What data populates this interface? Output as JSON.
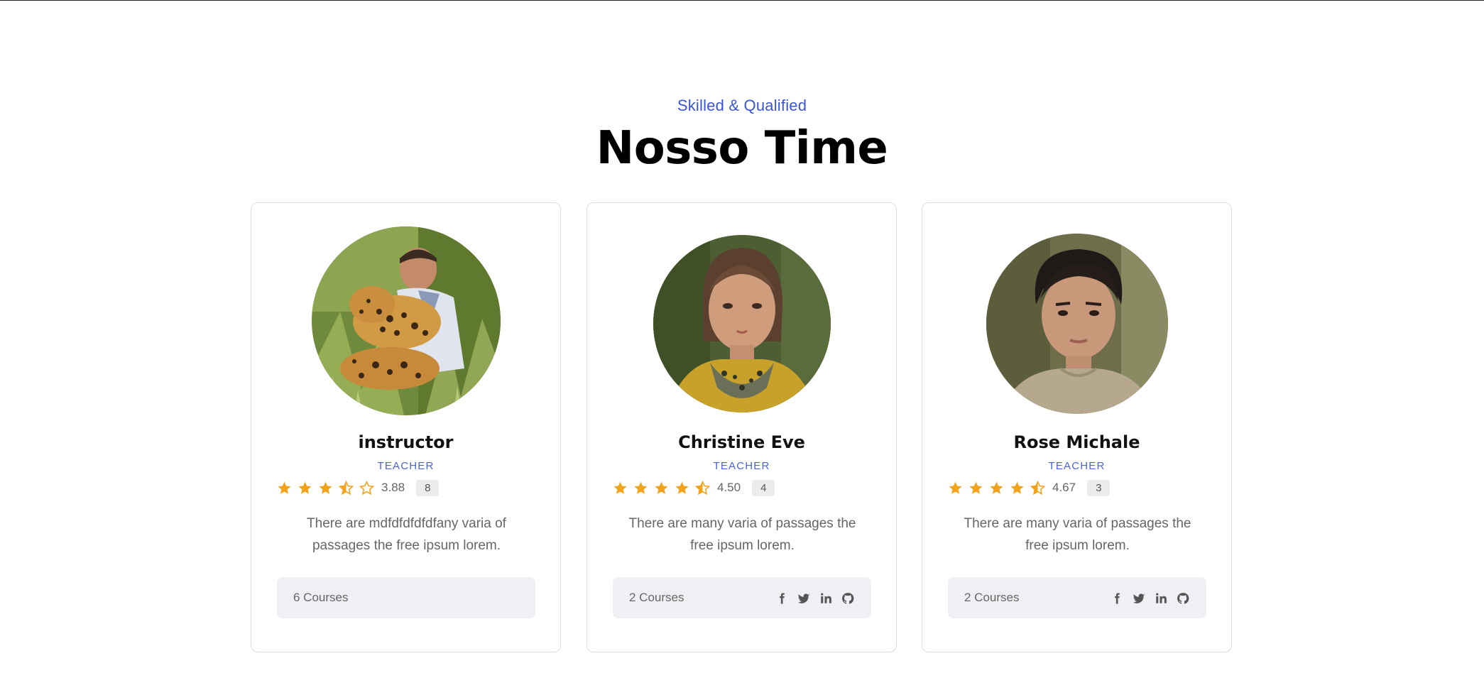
{
  "header": {
    "eyebrow": "Skilled & Qualified",
    "title": "Nosso Time"
  },
  "colors": {
    "accent": "#3a55d6",
    "star": "#f2a31b",
    "card_border": "#dcdce3",
    "footer_bg": "#eff0f4"
  },
  "instructors": [
    {
      "name": "instructor",
      "role": "TEACHER",
      "stars": [
        "star-full-icon",
        "star-full-icon",
        "star-full-icon",
        "star-half-icon",
        "star-empty-icon"
      ],
      "rating": "3.88",
      "review_count": "8",
      "description": "There are mdfdfdfdfdfany varia of passages the free ipsum lorem.",
      "courses": "6 Courses",
      "socials": []
    },
    {
      "name": "Christine Eve",
      "role": "TEACHER",
      "stars": [
        "star-full-icon",
        "star-full-icon",
        "star-full-icon",
        "star-full-icon",
        "star-half-icon"
      ],
      "rating": "4.50",
      "review_count": "4",
      "description": "There are many varia of passages the free ipsum lorem.",
      "courses": "2 Courses",
      "socials": [
        "facebook-icon",
        "twitter-icon",
        "linkedin-icon",
        "github-icon"
      ]
    },
    {
      "name": "Rose Michale",
      "role": "TEACHER",
      "stars": [
        "star-full-icon",
        "star-full-icon",
        "star-full-icon",
        "star-full-icon",
        "star-half-icon"
      ],
      "rating": "4.67",
      "review_count": "3",
      "description": "There are many varia of passages the free ipsum lorem.",
      "courses": "2 Courses",
      "socials": [
        "facebook-icon",
        "twitter-icon",
        "linkedin-icon",
        "github-icon"
      ]
    }
  ]
}
